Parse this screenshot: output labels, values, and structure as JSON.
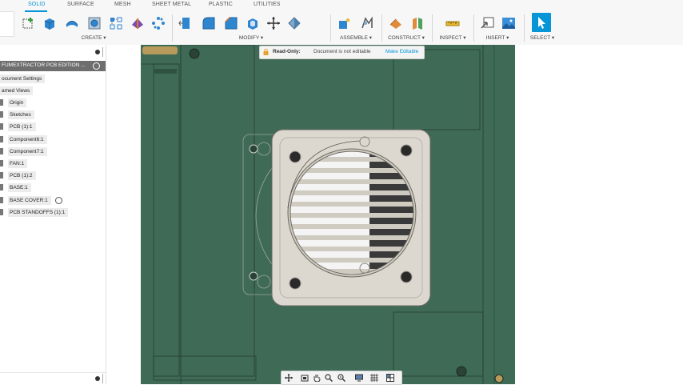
{
  "ribbon": {
    "tabs": [
      {
        "label": "SOLID",
        "active": true
      },
      {
        "label": "SURFACE",
        "active": false
      },
      {
        "label": "MESH",
        "active": false
      },
      {
        "label": "SHEET METAL",
        "active": false
      },
      {
        "label": "PLASTIC",
        "active": false
      },
      {
        "label": "UTILITIES",
        "active": false
      }
    ],
    "groups": {
      "create": "CREATE ▾",
      "modify": "MODIFY ▾",
      "assemble": "ASSEMBLE ▾",
      "construct": "CONSTRUCT ▾",
      "inspect": "INSPECT ▾",
      "insert": "INSERT ▾",
      "select": "SELECT ▾"
    }
  },
  "browser": {
    "title": "FUMEXTRACTOR PCB EDITION ...",
    "items": [
      {
        "label": "ocument Settings"
      },
      {
        "label": "amed Views"
      },
      {
        "label": "Origin"
      },
      {
        "label": "Sketches"
      },
      {
        "label": "PCB (1):1"
      },
      {
        "label": "Component6:1"
      },
      {
        "label": "Component7:1"
      },
      {
        "label": "FAN:1"
      },
      {
        "label": "PCB (1):2"
      },
      {
        "label": "BASE:1"
      },
      {
        "label": "BASE COVER:1"
      },
      {
        "label": "PCB STANDOFFS (1):1"
      }
    ]
  },
  "banner": {
    "read_only": "Read-Only:",
    "message": "Document is not editable",
    "link": "Make Editable"
  },
  "colors": {
    "accent": "#0696d7",
    "body_green": "#3f6b56",
    "fan_cover": "#dcd8cf"
  }
}
